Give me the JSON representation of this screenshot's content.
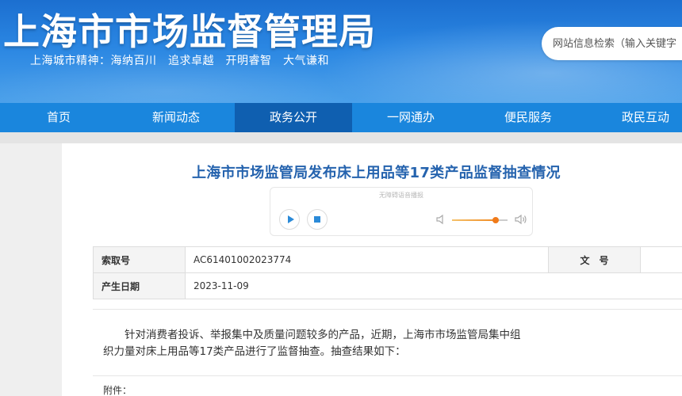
{
  "header": {
    "site_title": "上海市市场监督管理局",
    "city_spirit": "上海城市精神：海纳百川　追求卓越　开明睿智　大气谦和",
    "search_placeholder": "网站信息检索（输入关键字"
  },
  "nav": {
    "items": [
      "首页",
      "新闻动态",
      "政务公开",
      "一网通办",
      "便民服务",
      "政民互动"
    ],
    "active": "政务公开"
  },
  "article": {
    "title": "上海市市场监管局发布床上用品等17类产品监督抽查情况",
    "player": {
      "caption": "无障碍语音播报",
      "volume": 0.78
    },
    "meta": {
      "index_label": "索取号",
      "index_value": "AC61401002023774",
      "doc_no_label": "文　号",
      "doc_no_value": "",
      "date_label": "产生日期",
      "date_value": "2023-11-09"
    },
    "body": "针对消费者投诉、举报集中及质量问题较多的产品，近期，上海市市场监管局集中组织力量对床上用品等17类产品进行了监督抽查。抽查结果如下：",
    "attachment_label": "附件："
  },
  "colors": {
    "nav_bg": "#1a86dd",
    "nav_active": "#0f5fb0",
    "title_blue": "#2563ae",
    "player_accent": "#2b8ad8",
    "volume_orange": "#f07a1a"
  }
}
